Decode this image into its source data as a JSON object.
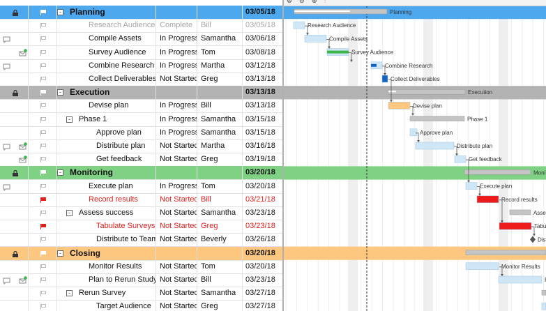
{
  "rows": [
    {
      "parent": true,
      "level": 0,
      "name": "Planning",
      "status": "",
      "assigned": "",
      "end": "03/05/18",
      "bg": "#4ea8ee",
      "lock": true,
      "flag": "white-flag",
      "toggle": "-"
    },
    {
      "level": 2,
      "name": "Research Audience",
      "status": "Complete",
      "assigned": "Bill",
      "end": "03/05/18",
      "style": "grey",
      "flag": "outline-flag"
    },
    {
      "level": 2,
      "name": "Compile Assets",
      "status": "In Progress",
      "assigned": "Samantha",
      "end": "03/06/18",
      "comment": true,
      "flag": "outline-flag"
    },
    {
      "level": 2,
      "name": "Survey Audience",
      "status": "In Progress",
      "assigned": "Tom",
      "end": "03/08/18",
      "mail": true,
      "flag": "outline-flag"
    },
    {
      "level": 2,
      "name": "Combine Research",
      "status": "In Progress",
      "assigned": "Martha",
      "end": "03/12/18",
      "comment": true,
      "flag": "outline-flag"
    },
    {
      "level": 2,
      "name": "Collect Deliverables",
      "status": "Not Started",
      "assigned": "Greg",
      "end": "03/13/18",
      "flag": "outline-flag"
    },
    {
      "parent": true,
      "level": 0,
      "name": "Execution",
      "status": "",
      "assigned": "",
      "end": "03/13/18",
      "bg": "#b3b3b3",
      "lock": true,
      "flag": "white-flag",
      "toggle": "-"
    },
    {
      "level": 2,
      "name": "Devise plan",
      "status": "In Progress",
      "assigned": "Bill",
      "end": "03/13/18",
      "flag": "outline-flag"
    },
    {
      "level": 1,
      "name": "Phase 1",
      "status": "In Progress",
      "assigned": "Samantha",
      "end": "03/15/18",
      "flag": "outline-flag",
      "toggle": "-"
    },
    {
      "level": 3,
      "name": "Approve plan",
      "status": "In Progress",
      "assigned": "Samantha",
      "end": "03/15/18",
      "flag": "outline-flag"
    },
    {
      "level": 3,
      "name": "Distribute plan",
      "status": "Not Started",
      "assigned": "Martha",
      "end": "03/16/18",
      "comment": true,
      "mail": true,
      "flag": "outline-flag"
    },
    {
      "level": 3,
      "name": "Get feedback",
      "status": "Not Started",
      "assigned": "Greg",
      "end": "03/19/18",
      "mail": true,
      "flag": "outline-flag"
    },
    {
      "parent": true,
      "level": 0,
      "name": "Monitoring",
      "status": "",
      "assigned": "",
      "end": "03/20/18",
      "bg": "#7fd184",
      "lock": true,
      "flag": "white-flag",
      "toggle": "-"
    },
    {
      "level": 2,
      "name": "Execute plan",
      "status": "In Progress",
      "assigned": "Tom",
      "end": "03/20/18",
      "comment": true,
      "flag": "outline-flag"
    },
    {
      "level": 2,
      "name": "Record results",
      "status": "Not Started",
      "assigned": "Bill",
      "end": "03/21/18",
      "style": "red",
      "flag": "red-flag"
    },
    {
      "level": 1,
      "name": "Assess success",
      "status": "Not Started",
      "assigned": "Samantha",
      "end": "03/23/18",
      "flag": "outline-flag",
      "toggle": "-"
    },
    {
      "level": 3,
      "name": "Tabulate Surveys",
      "status": "Not Started",
      "assigned": "Greg",
      "end": "03/23/18",
      "style": "red",
      "flag": "red-flag"
    },
    {
      "level": 3,
      "name": "Distribute to Team",
      "status": "Not Started",
      "assigned": "Beverly",
      "end": "03/26/18",
      "flag": "outline-flag"
    },
    {
      "parent": true,
      "level": 0,
      "name": "Closing",
      "status": "",
      "assigned": "",
      "end": "03/20/18",
      "bg": "#fdc77f",
      "lock": true,
      "flag": "white-flag",
      "toggle": "-"
    },
    {
      "level": 2,
      "name": "Monitor Results",
      "status": "Not Started",
      "assigned": "Tom",
      "end": "03/20/18",
      "flag": "outline-flag"
    },
    {
      "level": 2,
      "name": "Plan to Rerun Study",
      "status": "Not Started",
      "assigned": "Bill",
      "end": "03/23/18",
      "comment": true,
      "mail": true,
      "flag": "outline-flag"
    },
    {
      "level": 1,
      "name": "Rerun Survey",
      "status": "Not Started",
      "assigned": "Samantha",
      "end": "03/27/18",
      "flag": "outline-flag",
      "toggle": "-"
    },
    {
      "level": 3,
      "name": "Target Audience",
      "status": "Not Started",
      "assigned": "Greg",
      "end": "03/27/18",
      "flag": "outline-flag"
    }
  ],
  "gantt": {
    "bars": [
      {
        "label": "Planning",
        "kind": "summary",
        "color": "#c4c4c4",
        "progress": 0.6
      },
      {
        "label": "Research Audience",
        "kind": "task",
        "color": "#cfe6f7",
        "progress": 1.0
      },
      {
        "label": "Compile Assets",
        "kind": "task",
        "color": "#cfe6f7",
        "progress": 0.5
      },
      {
        "label": "Survey Audience",
        "kind": "task",
        "color": "#cfe6f7",
        "progress": 1.0,
        "fill": "#3cb54a"
      },
      {
        "label": "Combine Research",
        "kind": "task",
        "color": "#cfe6f7",
        "progress": 0.5,
        "fill": "#1565c0"
      },
      {
        "label": "Collect Deliverables",
        "kind": "task",
        "color": "#1565c0",
        "progress": 0
      },
      {
        "label": "Execution",
        "kind": "summary",
        "color": "#c4c4c4",
        "progress": 0.1
      },
      {
        "label": "Devise plan",
        "kind": "task",
        "color": "#fdc77f",
        "progress": 0
      },
      {
        "label": "Phase 1",
        "kind": "summary",
        "color": "#c4c4c4",
        "progress": 0
      },
      {
        "label": "Approve plan",
        "kind": "task",
        "color": "#cfe6f7",
        "progress": 0
      },
      {
        "label": "Distribute plan",
        "kind": "task",
        "color": "#cfe6f7",
        "progress": 0
      },
      {
        "label": "Get feedback",
        "kind": "task",
        "color": "#cfe6f7",
        "progress": 0
      },
      {
        "label": "Monitoring",
        "kind": "summary",
        "color": "#c4c4c4",
        "progress": 0
      },
      {
        "label": "Execute plan",
        "kind": "task",
        "color": "#cfe6f7",
        "progress": 0
      },
      {
        "label": "Record results",
        "kind": "task",
        "color": "#ee1b1b",
        "progress": 0
      },
      {
        "label": "Assess success",
        "kind": "summary",
        "color": "#c4c4c4",
        "progress": 0
      },
      {
        "label": "Tabulate Surveys",
        "kind": "task",
        "color": "#ee1b1b",
        "progress": 0
      },
      {
        "label": "Distribute to Team",
        "kind": "milestone",
        "color": "#555555",
        "progress": 0
      },
      {
        "label": "Closing",
        "kind": "summary",
        "color": "#c4c4c4",
        "progress": 0
      },
      {
        "label": "Monitor Results",
        "kind": "task",
        "color": "#cfe6f7",
        "progress": 0
      },
      {
        "label": "Plan to Rerun Study",
        "kind": "task",
        "color": "#cfe6f7",
        "progress": 0
      },
      {
        "label": "Rerun Survey",
        "kind": "summary",
        "color": "#c4c4c4",
        "progress": 0
      },
      {
        "label": "Target Audience",
        "kind": "task",
        "color": "#cfe6f7",
        "progress": 0
      }
    ]
  }
}
